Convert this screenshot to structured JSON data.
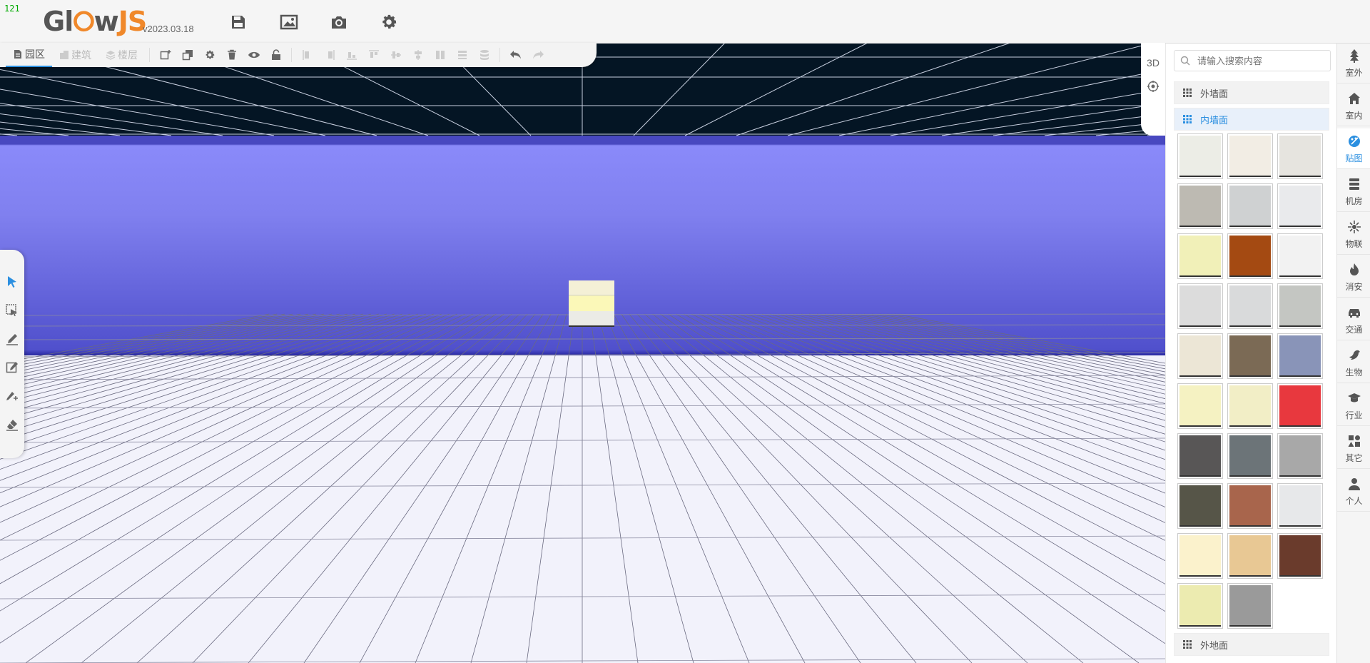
{
  "fps": "121",
  "app": {
    "logo_part1": "Gl",
    "logo_part2": "w",
    "logo_part3": "JS",
    "version": "v2023.03.18"
  },
  "top_actions": [
    "save-icon",
    "image-icon",
    "camera-icon",
    "settings-icon"
  ],
  "toolbar": {
    "tabs": [
      {
        "label": "园区",
        "icon": "document-icon",
        "active": true
      },
      {
        "label": "建筑",
        "icon": "building-icon",
        "active": false
      },
      {
        "label": "楼层",
        "icon": "layers-icon",
        "active": false
      }
    ]
  },
  "viewport": {
    "mode_label": "3D"
  },
  "panel": {
    "search_placeholder": "请输入搜索内容",
    "categories": [
      {
        "label": "外墙面",
        "active": false
      },
      {
        "label": "内墙面",
        "active": true
      },
      {
        "label": "外地面",
        "active": false
      }
    ],
    "textures": [
      "#ecede6",
      "#f2ede4",
      "#e6e4df",
      "#bdbab2",
      "#cfd1d2",
      "#e9eaec",
      "#f1f0b8",
      "#a44a12",
      "#f2f2f2",
      "#dcdcdc",
      "#d9dadb",
      "#c4c6c2",
      "#ece6d6",
      "#7b6a55",
      "#8994b8",
      "#f5f2c2",
      "#f2eec6",
      "#e8383e",
      "#585656",
      "#6c7478",
      "#a8a8a8",
      "#565548",
      "#a8654c",
      "#e7e8ea",
      "#fbf2cc",
      "#e8c894",
      "#6a3b2c",
      "#ecebb0",
      "#9a9a9a"
    ]
  },
  "sidenav": {
    "items": [
      {
        "label": "室外",
        "icon": "tree-icon",
        "active": false
      },
      {
        "label": "室内",
        "icon": "home-icon",
        "active": false
      },
      {
        "label": "贴图",
        "icon": "palette-icon",
        "active": true
      },
      {
        "label": "机房",
        "icon": "server-icon",
        "active": false
      },
      {
        "label": "物联",
        "icon": "iot-icon",
        "active": false
      },
      {
        "label": "消安",
        "icon": "fire-icon",
        "active": false
      },
      {
        "label": "交通",
        "icon": "car-icon",
        "active": false
      },
      {
        "label": "生物",
        "icon": "bird-icon",
        "active": false
      },
      {
        "label": "行业",
        "icon": "graduation-icon",
        "active": false
      },
      {
        "label": "其它",
        "icon": "shapes-icon",
        "active": false
      },
      {
        "label": "个人",
        "icon": "user-icon",
        "active": false
      }
    ]
  }
}
